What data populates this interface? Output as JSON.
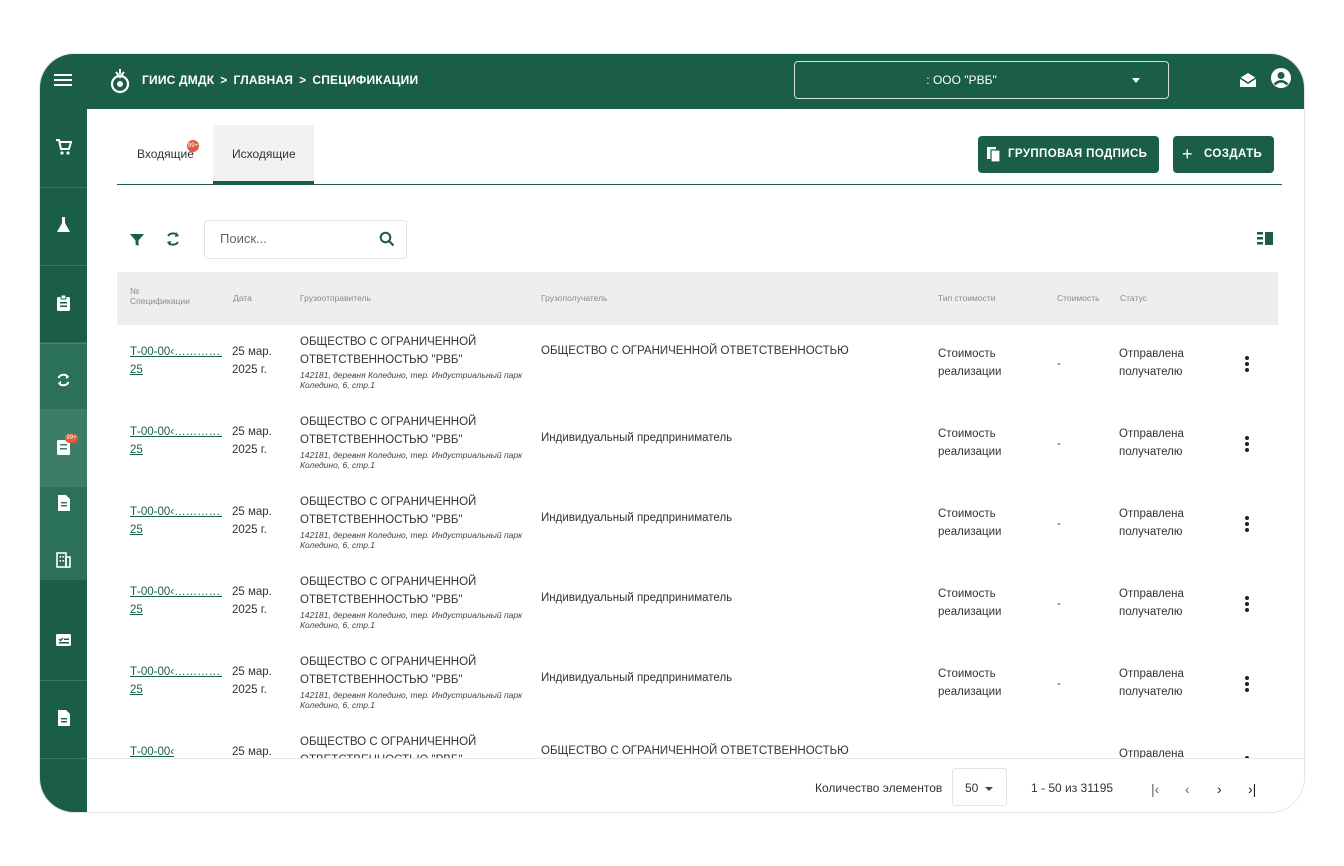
{
  "header": {
    "breadcrumb": [
      "ГИИС ДМДК",
      "ГЛАВНАЯ",
      "СПЕЦИФИКАЦИИ"
    ],
    "separator": ">",
    "org_select": ": ООО \"РВБ\""
  },
  "sidebar": {
    "items": [
      "cart-icon",
      "flask-icon",
      "clipboard-icon",
      "sync-icon",
      "document-list-icon",
      "document-icon",
      "building-icon",
      "checklist-icon",
      "file-icon"
    ],
    "badge": "99+"
  },
  "tabs": [
    {
      "label": "Входящие",
      "badge": "99+"
    },
    {
      "label": "Исходящие",
      "active": true
    }
  ],
  "actions": {
    "group_sign": "ГРУППОВАЯ ПОДПИСЬ",
    "create": "СОЗДАТЬ",
    "create_symbol": "+"
  },
  "search": {
    "placeholder": "Поиск..."
  },
  "table": {
    "columns": {
      "num_line1": "№",
      "num_line2": "Спецификации",
      "date": "Дата",
      "sender": "Грузоотправитель",
      "receiver": "Грузополучатель",
      "cost_type": "Тип стоимости",
      "cost": "Стоимость",
      "status": "Статус"
    },
    "rows": [
      {
        "num1": "Т-00-00‹……………-",
        "num2": "25",
        "date1": "25 мар.",
        "date2": "2025 г.",
        "sender_name": "ОБЩЕСТВО С ОГРАНИЧЕННОЙ ОТВЕТСТВЕННОСТЬЮ \"РВБ\"",
        "sender_addr": "142181, деревня Коледино, тер. Индустриальный парк Коледино, 6, стр.1",
        "receiver": "ОБЩЕСТВО С ОГРАНИЧЕННОЙ ОТВЕТСТВЕННОСТЬЮ",
        "cost_type1": "Стоимость",
        "cost_type2": "реализации",
        "cost": "-",
        "status1": "Отправлена",
        "status2": "получателю"
      },
      {
        "num1": "Т-00-00‹……………-",
        "num2": "25",
        "date1": "25 мар.",
        "date2": "2025 г.",
        "sender_name": "ОБЩЕСТВО С ОГРАНИЧЕННОЙ ОТВЕТСТВЕННОСТЬЮ \"РВБ\"",
        "sender_addr": "142181, деревня Коледино, тер. Индустриальный парк Коледино, 6, стр.1",
        "receiver": "Индивидуальный предприниматель",
        "cost_type1": "Стоимость",
        "cost_type2": "реализации",
        "cost": "-",
        "status1": "Отправлена",
        "status2": "получателю"
      },
      {
        "num1": "Т-00-00‹……………-",
        "num2": "25",
        "date1": "25 мар.",
        "date2": "2025 г.",
        "sender_name": "ОБЩЕСТВО С ОГРАНИЧЕННОЙ ОТВЕТСТВЕННОСТЬЮ \"РВБ\"",
        "sender_addr": "142181, деревня Коледино, тер. Индустриальный парк Коледино, 6, стр.1",
        "receiver": "Индивидуальный предприниматель",
        "cost_type1": "Стоимость",
        "cost_type2": "реализации",
        "cost": "-",
        "status1": "Отправлена",
        "status2": "получателю"
      },
      {
        "num1": "Т-00-00‹……………-",
        "num2": "25",
        "date1": "25 мар.",
        "date2": "2025 г.",
        "sender_name": "ОБЩЕСТВО С ОГРАНИЧЕННОЙ ОТВЕТСТВЕННОСТЬЮ \"РВБ\"",
        "sender_addr": "142181, деревня Коледино, тер. Индустриальный парк Коледино, 6, стр.1",
        "receiver": "Индивидуальный предприниматель",
        "cost_type1": "Стоимость",
        "cost_type2": "реализации",
        "cost": "-",
        "status1": "Отправлена",
        "status2": "получателю"
      },
      {
        "num1": "Т-00-00‹……………-",
        "num2": "25",
        "date1": "25 мар.",
        "date2": "2025 г.",
        "sender_name": "ОБЩЕСТВО С ОГРАНИЧЕННОЙ ОТВЕТСТВЕННОСТЬЮ \"РВБ\"",
        "sender_addr": "142181, деревня Коледино, тер. Индустриальный парк Коледино, 6, стр.1",
        "receiver": "Индивидуальный предприниматель",
        "cost_type1": "Стоимость",
        "cost_type2": "реализации",
        "cost": "-",
        "status1": "Отправлена",
        "status2": "получателю"
      },
      {
        "num1": "Т-00-00‹",
        "num2": "",
        "date1": "25 мар.",
        "date2": "",
        "sender_name": "ОБЩЕСТВО С ОГРАНИЧЕННОЙ ОТВЕТСТВЕННОСТЬЮ \"РВБ\"",
        "sender_addr": "",
        "receiver": "ОБЩЕСТВО С ОГРАНИЧЕННОЙ ОТВЕТСТВЕННОСТЬЮ",
        "cost_type1": "",
        "cost_type2": "",
        "cost": "",
        "status1": "Отправлена",
        "status2": ""
      }
    ]
  },
  "pagination": {
    "items_label": "Количество элементов",
    "page_size": "50",
    "range": "1 - 50 из 31195",
    "first": "|‹",
    "prev": "‹",
    "next": "›",
    "last": "›|"
  },
  "colors": {
    "brand": "#1b5e48",
    "badge": "#e55a3c"
  }
}
